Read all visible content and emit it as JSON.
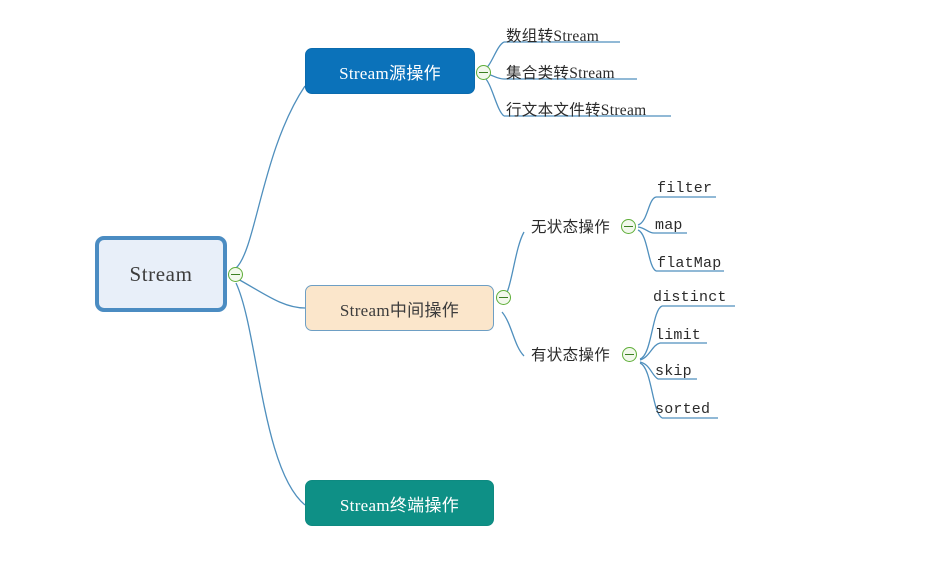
{
  "diagram": {
    "type": "mindmap",
    "title": "Stream",
    "background_color": "#ffffff",
    "edge_color": "#4f8fbd",
    "toggle_color": "#5fae39"
  },
  "root": {
    "label": "Stream",
    "fill": "#e8eff9",
    "border": "#4b8cc2",
    "text_color": "#3c3c3c"
  },
  "branches": [
    {
      "label": "Stream源操作",
      "fill": "#0b72ba",
      "text_color": "#ffffff",
      "children": [
        {
          "label": "数组转Stream"
        },
        {
          "label": "集合类转Stream"
        },
        {
          "label": "行文本文件转Stream"
        }
      ]
    },
    {
      "label": "Stream中间操作",
      "fill": "#fbe6cb",
      "text_color": "#3c3c3c",
      "groups": [
        {
          "label": "无状态操作",
          "children": [
            {
              "label": "filter"
            },
            {
              "label": "map"
            },
            {
              "label": "flatMap"
            }
          ]
        },
        {
          "label": "有状态操作",
          "children": [
            {
              "label": "distinct"
            },
            {
              "label": "limit"
            },
            {
              "label": "skip"
            },
            {
              "label": "sorted"
            }
          ]
        }
      ]
    },
    {
      "label": "Stream终端操作",
      "fill": "#0e9086",
      "text_color": "#ffffff",
      "children": []
    }
  ],
  "toggles": [
    {
      "name": "root-toggle",
      "state": "expanded",
      "glyph": "minus"
    },
    {
      "name": "source-toggle",
      "state": "expanded",
      "glyph": "minus"
    },
    {
      "name": "middle-toggle",
      "state": "expanded",
      "glyph": "minus"
    },
    {
      "name": "stateless-toggle",
      "state": "expanded",
      "glyph": "minus"
    },
    {
      "name": "stateful-toggle",
      "state": "expanded",
      "glyph": "minus"
    }
  ]
}
